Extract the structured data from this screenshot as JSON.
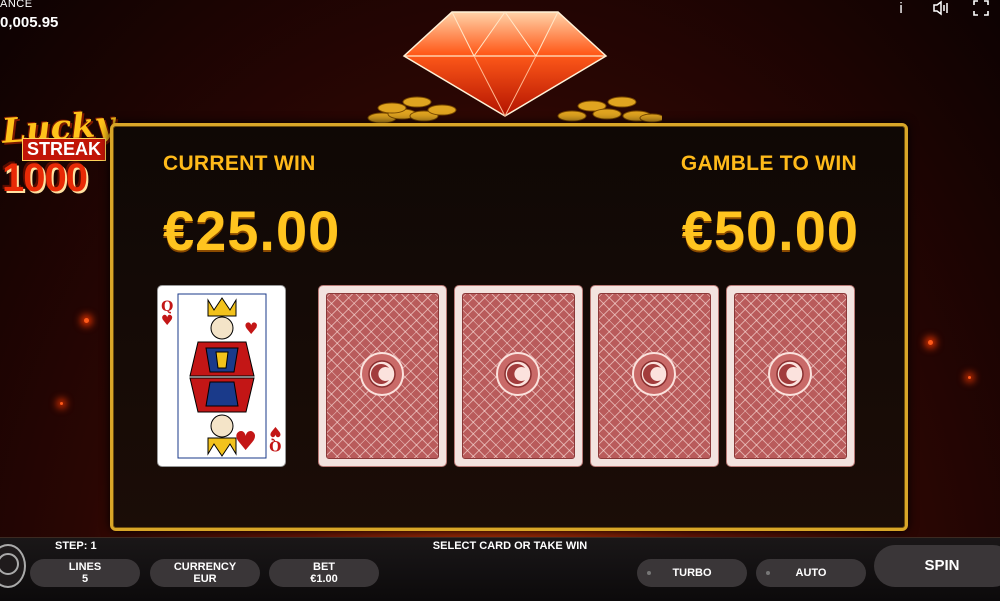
{
  "header": {
    "balance_label": "ANCE",
    "balance_value": "0,005.95",
    "icons": [
      "info-icon",
      "sound-icon",
      "fullscreen-icon"
    ]
  },
  "logo": {
    "line1": "Lucky",
    "line2": "STREAK",
    "line3": "1000"
  },
  "panel": {
    "current_win_label": "CURRENT WIN",
    "current_win_value": "€25.00",
    "gamble_label": "GAMBLE TO WIN",
    "gamble_value": "€50.00",
    "revealed_card": {
      "rank": "Q",
      "suit": "hearts"
    },
    "face_down_cards": 4
  },
  "bottom": {
    "step": "STEP: 1",
    "message": "SELECT CARD OR TAKE WIN",
    "lines_label": "LINES",
    "lines_value": "5",
    "currency_label": "CURRENCY",
    "currency_value": "EUR",
    "bet_label": "BET",
    "bet_value": "€1.00",
    "turbo_label": "TURBO",
    "auto_label": "AUTO",
    "spin_label": "SPIN"
  },
  "colors": {
    "gold": "#ffc41f",
    "frame": "#d9a628",
    "card_back": "#b95b5b"
  }
}
